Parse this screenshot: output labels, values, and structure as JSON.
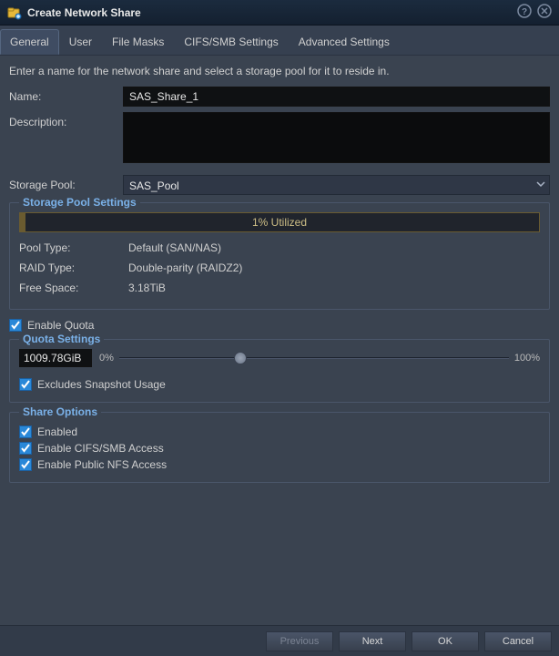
{
  "window": {
    "title": "Create Network Share",
    "instructions": "Enter a name for the network share and select a storage pool for it to reside in."
  },
  "tabs": [
    {
      "label": "General",
      "active": true
    },
    {
      "label": "User",
      "active": false
    },
    {
      "label": "File Masks",
      "active": false
    },
    {
      "label": "CIFS/SMB Settings",
      "active": false
    },
    {
      "label": "Advanced Settings",
      "active": false
    }
  ],
  "form": {
    "name_label": "Name:",
    "name_value": "SAS_Share_1",
    "description_label": "Description:",
    "description_value": "",
    "storage_pool_label": "Storage Pool:",
    "storage_pool_value": "SAS_Pool"
  },
  "pool_settings": {
    "legend": "Storage Pool Settings",
    "utilized_percent": 1,
    "utilized_label": "1% Utilized",
    "pool_type_label": "Pool Type:",
    "pool_type_value": "Default (SAN/NAS)",
    "raid_type_label": "RAID Type:",
    "raid_type_value": "Double-parity (RAIDZ2)",
    "free_space_label": "Free Space:",
    "free_space_value": "3.18TiB"
  },
  "enable_quota_label": "Enable Quota",
  "quota_settings": {
    "legend": "Quota Settings",
    "value": "1009.78GiB",
    "slider_min_label": "0%",
    "slider_max_label": "100%",
    "slider_percent": 31,
    "excludes_snapshot_label": "Excludes Snapshot Usage"
  },
  "share_options": {
    "legend": "Share Options",
    "enabled_label": "Enabled",
    "cifs_label": "Enable CIFS/SMB Access",
    "nfs_label": "Enable Public NFS Access"
  },
  "buttons": {
    "previous": "Previous",
    "next": "Next",
    "ok": "OK",
    "cancel": "Cancel"
  }
}
